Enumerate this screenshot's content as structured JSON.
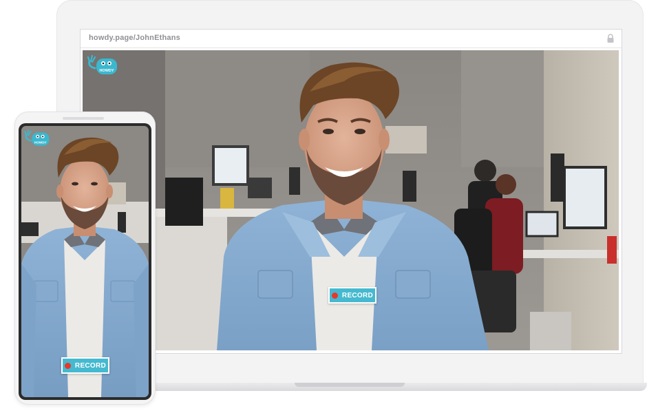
{
  "browser": {
    "url": "howdy.page/JohnEthans"
  },
  "logo": {
    "text": "HOWDY",
    "color": "#3bb8cf"
  },
  "record": {
    "label": "RECORD",
    "dot_color": "#e8372b",
    "button_color": "#45b9cf"
  },
  "icons": {
    "lock": "lock-icon"
  }
}
